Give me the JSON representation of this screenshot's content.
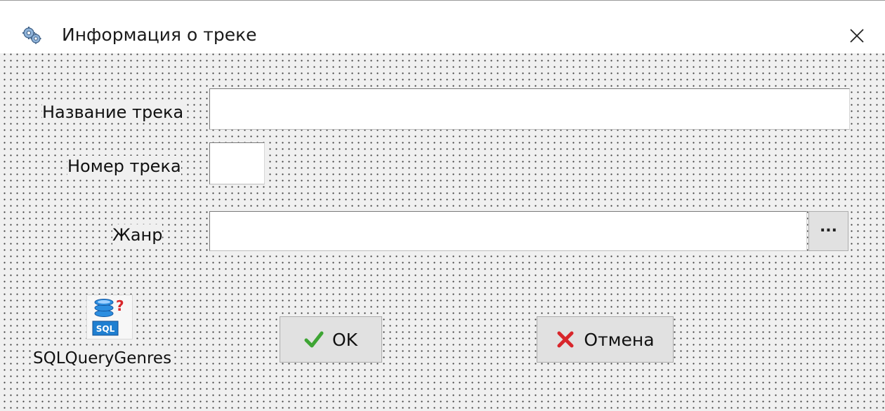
{
  "window": {
    "title": "Информация о треке",
    "app_icon": "gears-icon",
    "close_icon": "close-icon"
  },
  "form": {
    "track_name": {
      "label": "Название трека",
      "value": "",
      "placeholder": ""
    },
    "track_number": {
      "label": "Номер трека",
      "value": "",
      "placeholder": ""
    },
    "genre": {
      "label": "Жанр",
      "value": "",
      "placeholder": "",
      "browse_label": "..."
    }
  },
  "components": {
    "sql_query": {
      "caption": "SQLQueryGenres",
      "icon": "sql-query-icon",
      "icon_text": "SQL",
      "badge": "?"
    }
  },
  "buttons": {
    "ok": {
      "label": "OK",
      "icon": "checkmark-icon",
      "icon_color": "#3ea534"
    },
    "cancel": {
      "label": "Отмена",
      "icon": "cross-icon",
      "icon_color": "#d8262b"
    }
  },
  "colors": {
    "dialog_background": "#f0f0f0",
    "button_face": "#e1e1e1",
    "sql_icon_blue": "#1f7fd1"
  }
}
